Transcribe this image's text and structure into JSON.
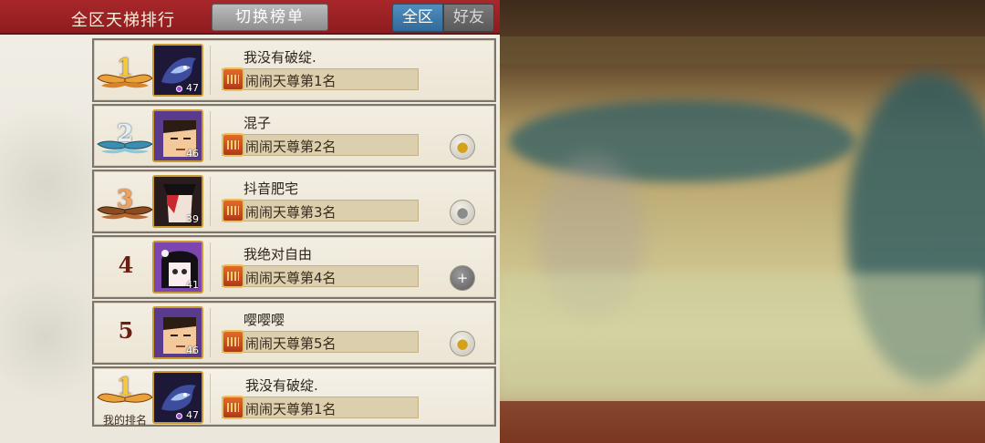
{
  "header": {
    "title": "全区天梯排行",
    "switch_label": "切换榜单",
    "tabs": [
      {
        "label": "全区",
        "active": true
      },
      {
        "label": "好友",
        "active": false
      }
    ]
  },
  "rankings": [
    {
      "rank": "1",
      "name": "我没有破绽.",
      "level": "47",
      "title": "闹闹天尊第1名",
      "avatar": "purple-dragon-avatar-icon",
      "action": "none"
    },
    {
      "rank": "2",
      "name": "混子",
      "level": "46",
      "title": "闹闹天尊第2名",
      "avatar": "hero-face-avatar-icon",
      "action": "gold-coin-icon"
    },
    {
      "rank": "3",
      "name": "抖音肥宅",
      "level": "39",
      "title": "闹闹天尊第3名",
      "avatar": "masked-hero-avatar-icon",
      "action": "silver-coin-icon"
    },
    {
      "rank": "4",
      "name": "我绝对自由",
      "level": "41",
      "title": "闹闹天尊第4名",
      "avatar": "girl-avatar-icon",
      "action": "add-friend-icon"
    },
    {
      "rank": "5",
      "name": "嘤嘤嘤",
      "level": "46",
      "title": "闹闹天尊第5名",
      "avatar": "hero-face-avatar-icon",
      "action": "gold-coin-icon"
    }
  ],
  "my_rank": {
    "rank": "1",
    "label": "我的排名",
    "name": "我没有破绽.",
    "level": "47",
    "title": "闹闹天尊第1名",
    "avatar": "purple-dragon-avatar-icon"
  },
  "colors": {
    "header_red": "#a8272a",
    "tab_active_blue": "#3f7eb0",
    "gold_wings": "#e8a23a",
    "silver_wings": "#3a8fb0",
    "bronze_wings": "#8a4a22",
    "rank_text": "#6b1d10"
  }
}
